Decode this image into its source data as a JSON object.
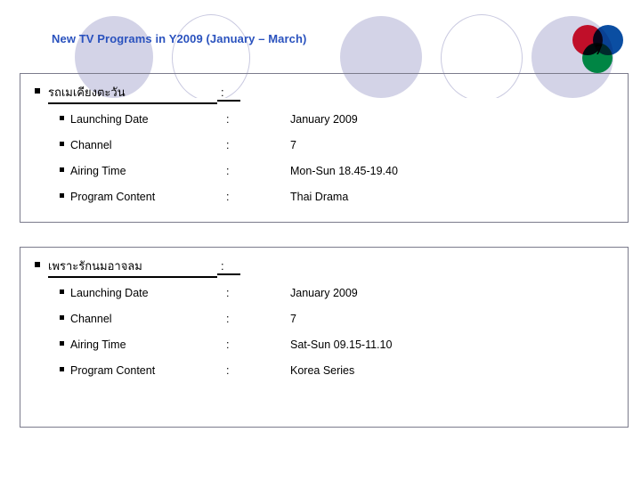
{
  "slide": {
    "title": "New TV Programs in Y2009 (January – March)",
    "title_color": "#2a52be"
  },
  "logo": {
    "name": "channel-7-logo",
    "digit": "7",
    "colors": {
      "red": "#e8112d",
      "blue": "#0b4ea2",
      "green": "#00a14b"
    }
  },
  "decor": {
    "circle_fill": "#d3d3e7",
    "circle_stroke": "#c9c9e0"
  },
  "programs": [
    {
      "heading": "รถเมเคียงตะวัน",
      "heading_colon": ":",
      "details": [
        {
          "label": "Launching Date",
          "sep": ":",
          "value": "January 2009"
        },
        {
          "label": "Channel",
          "sep": ":",
          "value": "7"
        },
        {
          "label": "Airing Time",
          "sep": ":",
          "value": "Mon-Sun 18.45-19.40"
        },
        {
          "label": "Program Content",
          "sep": ":",
          "value": "Thai Drama"
        }
      ]
    },
    {
      "heading": "เพราะรักนมอาจลม",
      "heading_colon": ":",
      "details": [
        {
          "label": "Launching Date",
          "sep": ":",
          "value": "January 2009"
        },
        {
          "label": "Channel",
          "sep": ":",
          "value": "7"
        },
        {
          "label": "Airing Time",
          "sep": ":",
          "value": "Sat-Sun 09.15-11.10"
        },
        {
          "label": "Program Content",
          "sep": ":",
          "value": "Korea Series"
        }
      ]
    }
  ]
}
